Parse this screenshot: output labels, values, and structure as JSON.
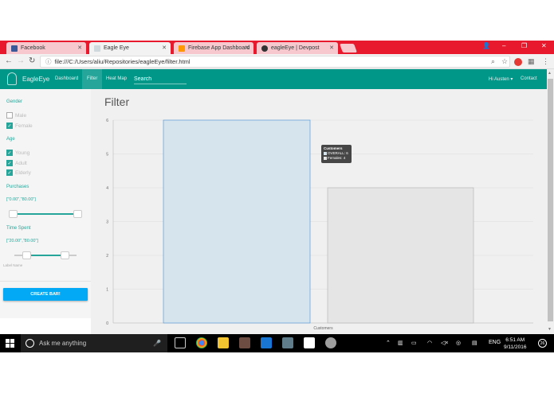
{
  "browser": {
    "tabs": [
      {
        "label": "Facebook",
        "color": "#3b5998"
      },
      {
        "label": "Eagle Eye",
        "color": "#90a4ae"
      },
      {
        "label": "Firebase App Dashboard",
        "color": "#ff9800"
      },
      {
        "label": "eagleEye | Devpost",
        "color": "#333333"
      }
    ],
    "url": "file:///C:/Users/aliu/Repositories/eagleEye/filter.html"
  },
  "appbar": {
    "brand": "EagleEye",
    "nav": [
      "Dashboard",
      "Filter",
      "Heat Map"
    ],
    "search_placeholder": "Search",
    "user": "Hi Austen ▾",
    "contact": "Contact"
  },
  "sidebar": {
    "gender_header": "Gender",
    "gender": [
      {
        "label": "Male",
        "checked": false
      },
      {
        "label": "Female",
        "checked": true
      }
    ],
    "age_header": "Age",
    "age": [
      {
        "label": "Young",
        "checked": true
      },
      {
        "label": "Adult",
        "checked": true
      },
      {
        "label": "Elderly",
        "checked": true
      }
    ],
    "purchases_header": "Purchases",
    "purchases_value": "[\"0.00\",\"80.00\"]",
    "time_header": "Time Spent",
    "time_value": "[\"20.00\",\"80.00\"]",
    "label_name": "Label Name",
    "create_button": "CREATE BAR!"
  },
  "main": {
    "title": "Filter"
  },
  "chart_data": {
    "type": "bar",
    "categories": [
      "Customers"
    ],
    "series": [
      {
        "name": "OVERALL",
        "values": [
          6
        ],
        "color": "#d6e4ee"
      },
      {
        "name": "Females",
        "values": [
          4
        ],
        "color": "#e5e5e5"
      }
    ],
    "xlabel": "Customers",
    "ylabel": "",
    "ylim": [
      0,
      6
    ],
    "yticks": [
      "0",
      "1",
      "2",
      "3",
      "4",
      "5",
      "6"
    ],
    "tooltip": {
      "title": "Customers",
      "lines": [
        "OVERALL: 6",
        "Females: 4"
      ]
    }
  },
  "taskbar": {
    "search_placeholder": "Ask me anything",
    "lang": "ENG",
    "time": "6:51 AM",
    "date": "9/11/2016",
    "notifications": "26"
  }
}
